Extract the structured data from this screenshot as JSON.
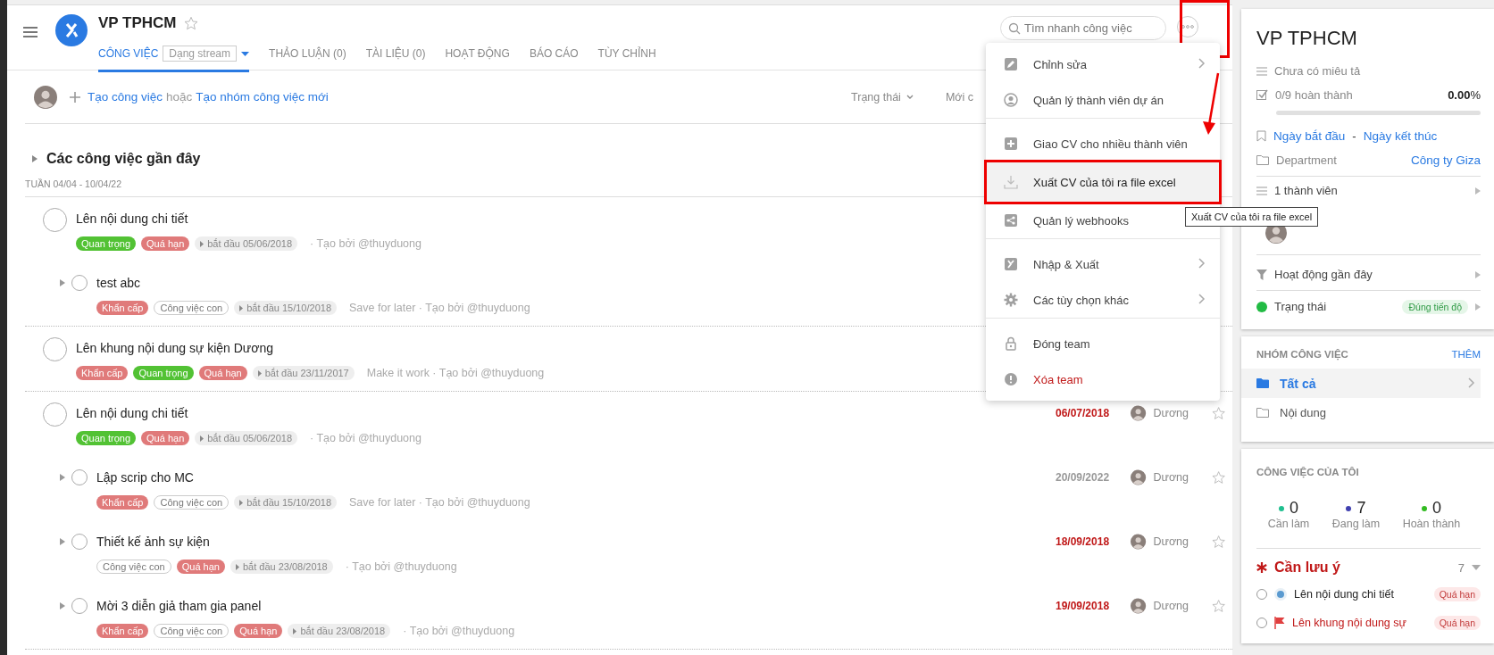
{
  "header": {
    "title": "VP TPHCM",
    "search": {
      "placeholder": "Tìm nhanh công việc"
    },
    "tabs": [
      {
        "label": "CÔNG VIỆC",
        "sub": "Dạng stream",
        "selected": true
      },
      {
        "label": "THẢO LUẬN (0)",
        "selected": false
      },
      {
        "label": "TÀI LIỆU (0)",
        "selected": false
      },
      {
        "label": "HOẠT ĐỘNG",
        "selected": false
      },
      {
        "label": "BÁO CÁO",
        "selected": false
      },
      {
        "label": "TÙY CHỈNH",
        "selected": false
      }
    ]
  },
  "toolbar": {
    "create": "Tạo công việc",
    "or": "hoặc",
    "create_group": "Tạo nhóm công việc mới",
    "filters": [
      "Trạng thái",
      "Mới c"
    ]
  },
  "section": {
    "title": "Các công việc gần đây",
    "week": "TUẦN 04/04 - 10/04/22"
  },
  "tasks": [
    {
      "title": "Lên nội dung chi tiết",
      "checked": false,
      "tags": [
        {
          "label": "Quan trọng",
          "kind": "important"
        },
        {
          "label": "Quá hạn",
          "kind": "overdue"
        },
        {
          "label": "bắt đầu 05/06/2018",
          "kind": "start"
        }
      ],
      "note": "· Tạo bởi @thuyduong",
      "children": [
        {
          "title": "test abc",
          "checked": false,
          "tags": [
            {
              "label": "Khẩn cấp",
              "kind": "urgent"
            },
            {
              "label": "Công việc con",
              "kind": "subtask"
            },
            {
              "label": "bắt đầu 15/10/2018",
              "kind": "start"
            }
          ],
          "note": "Save for later · Tạo bởi @thuyduong"
        }
      ]
    },
    {
      "title": "Lên khung nội dung sự kiện Dương",
      "checked": false,
      "tags": [
        {
          "label": "Khẩn cấp",
          "kind": "urgent"
        },
        {
          "label": "Quan trọng",
          "kind": "important"
        },
        {
          "label": "Quá hạn",
          "kind": "overdue"
        },
        {
          "label": "bắt đầu 23/11/2017",
          "kind": "start"
        }
      ],
      "note": "Make it work · Tạo bởi @thuyduong"
    },
    {
      "title": "Lên nội dung chi tiết",
      "checked": false,
      "tags": [
        {
          "label": "Quan trọng",
          "kind": "important"
        },
        {
          "label": "Quá hạn",
          "kind": "overdue"
        },
        {
          "label": "bắt đầu 05/06/2018",
          "kind": "start"
        }
      ],
      "note": "· Tạo bởi @thuyduong",
      "due": "06/07/2018",
      "overdue": true,
      "assignee": "Dương",
      "children": [
        {
          "title": "Lập scrip cho MC",
          "checked": false,
          "tags": [
            {
              "label": "Khẩn cấp",
              "kind": "urgent"
            },
            {
              "label": "Công việc con",
              "kind": "subtask"
            },
            {
              "label": "bắt đầu 15/10/2018",
              "kind": "start"
            }
          ],
          "note": "Save for later · Tạo bởi @thuyduong",
          "due": "20/09/2022",
          "overdue": false,
          "assignee": "Dương"
        },
        {
          "title": "Thiết kế ảnh sự kiện",
          "checked": false,
          "tags": [
            {
              "label": "Công việc con",
              "kind": "subtask"
            },
            {
              "label": "Quá hạn",
              "kind": "overdue"
            },
            {
              "label": "bắt đầu 23/08/2018",
              "kind": "start"
            }
          ],
          "note": "· Tạo bởi @thuyduong",
          "due": "18/09/2018",
          "overdue": true,
          "assignee": "Dương"
        },
        {
          "title": "Mời 3 diễn giả tham gia panel",
          "checked": false,
          "tags": [
            {
              "label": "Khẩn cấp",
              "kind": "urgent"
            },
            {
              "label": "Công việc con",
              "kind": "subtask"
            },
            {
              "label": "Quá hạn",
              "kind": "overdue"
            },
            {
              "label": "bắt đầu 23/08/2018",
              "kind": "start"
            }
          ],
          "note": "· Tạo bởi @thuyduong",
          "due": "19/09/2018",
          "overdue": true,
          "assignee": "Dương"
        }
      ]
    }
  ],
  "menu": {
    "items": [
      {
        "label": "Chỉnh sửa",
        "kind": "edit",
        "submenu": true,
        "selected": false,
        "danger": false,
        "divider_after": false
      },
      {
        "label": "Quản lý thành viên dự án",
        "kind": "members",
        "submenu": false,
        "selected": false,
        "danger": false,
        "divider_after": true
      },
      {
        "label": "Giao CV cho nhiều thành viên",
        "kind": "assign",
        "submenu": false,
        "selected": false,
        "danger": false,
        "divider_after": false
      },
      {
        "label": "Xuất CV của tôi ra file excel",
        "kind": "export",
        "submenu": false,
        "selected": true,
        "danger": false,
        "divider_after": false
      },
      {
        "label": "Quản lý webhooks",
        "kind": "webhooks",
        "submenu": false,
        "selected": false,
        "danger": false,
        "divider_after": true
      },
      {
        "label": "Nhập & Xuất",
        "kind": "import",
        "submenu": true,
        "selected": false,
        "danger": false,
        "divider_after": false
      },
      {
        "label": "Các tùy chọn khác",
        "kind": "options",
        "submenu": true,
        "selected": false,
        "danger": false,
        "divider_after": true
      },
      {
        "label": "Đóng team",
        "kind": "lock",
        "submenu": false,
        "selected": false,
        "danger": false,
        "divider_after": false
      },
      {
        "label": "Xóa team",
        "kind": "delete",
        "submenu": false,
        "selected": false,
        "danger": true,
        "divider_after": false
      }
    ]
  },
  "tooltip": "Xuất CV của tôi ra file excel",
  "project": {
    "title": "VP TPHCM",
    "description": "Chưa có miêu tả",
    "progress_text": "0/9 hoàn thành",
    "percent": "0.00",
    "percent_sign": "%",
    "level": 0,
    "start": "Ngày bắt đầu",
    "dash": "-",
    "end": "Ngày kết thúc",
    "department_label": "Department",
    "department": "Công ty Giza",
    "members": "1 thành viên",
    "activity": "Hoạt động gần đây",
    "status_label": "Trạng thái",
    "status": "Đúng tiến độ"
  },
  "groups": {
    "title": "NHÓM CÔNG VIỆC",
    "add": "THÊM",
    "items": [
      {
        "label": "Tất cả",
        "selected": true
      },
      {
        "label": "Nội dung",
        "selected": false
      }
    ]
  },
  "my_tasks": {
    "title": "CÔNG VIỆC CỦA TÔI",
    "stats": [
      {
        "value": "0",
        "label": "Cần làm",
        "color": "#1fbf8f"
      },
      {
        "value": "7",
        "label": "Đang làm",
        "color": "#4040b0"
      },
      {
        "value": "0",
        "label": "Hoàn thành",
        "color": "#33bb22"
      }
    ],
    "attention": {
      "title": "Cần lưu ý",
      "count": "7",
      "items": [
        {
          "title": "Lên nội dung chi tiết",
          "kind": "dot",
          "badge": "Quá hạn",
          "checked": false
        },
        {
          "title": "Lên khung nội dung sự",
          "kind": "flag",
          "badge": "Quá hạn",
          "checked": false
        }
      ]
    }
  }
}
